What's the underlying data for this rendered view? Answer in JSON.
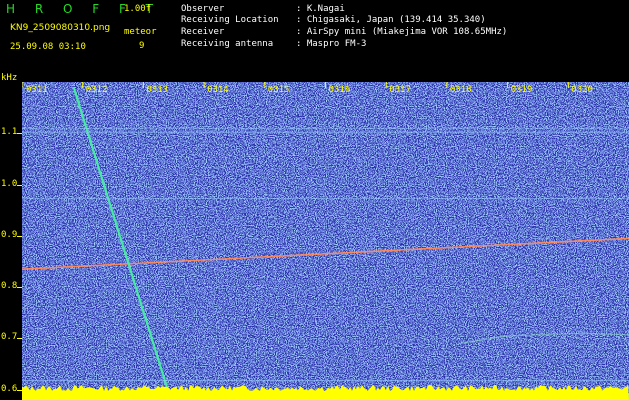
{
  "header": {
    "brand": "H R O F F T",
    "version": "1.00f",
    "filename": "KN9_2509080310.png",
    "datetime": "25.09.08 03:10",
    "meteor_label": "meteor",
    "meteor_count": "9"
  },
  "station": {
    "rows": [
      {
        "label": "Observer",
        "value": ": K.Nagai"
      },
      {
        "label": "Receiving Location",
        "value": ": Chigasaki, Japan (139.414 35.340)"
      },
      {
        "label": "Receiver",
        "value": ": AirSpy mini (Miakejima VOR 108.65MHz)"
      },
      {
        "label": "Receiving antenna",
        "value": ": Maspro FM-3"
      }
    ]
  },
  "chart_data": {
    "type": "heatmap",
    "ylabel": "kHz",
    "yticks": [
      "1.1",
      "1.0",
      "0.9",
      "0.8",
      "0.7",
      "0.6"
    ],
    "ytick_values": [
      1.1,
      1.0,
      0.9,
      0.8,
      0.7,
      0.6
    ],
    "ylim": [
      0.58,
      1.2
    ],
    "xticks": [
      "0311",
      "0312",
      "0313",
      "0314",
      "0315",
      "0316",
      "0317",
      "0318",
      "0319",
      "0320"
    ],
    "xlim_minutes": [
      0,
      10
    ],
    "traces": [
      {
        "kind": "carrier",
        "points": [
          [
            0,
            0.835
          ],
          [
            10,
            0.895
          ]
        ]
      },
      {
        "kind": "meteor-echo",
        "points": [
          [
            0.85,
            1.19
          ],
          [
            2.4,
            0.6
          ]
        ]
      },
      {
        "kind": "faint-line",
        "points": [
          [
            0,
            1.11
          ],
          [
            10,
            1.11
          ]
        ]
      },
      {
        "kind": "faint-line",
        "points": [
          [
            0,
            1.102
          ],
          [
            10,
            1.102
          ]
        ]
      },
      {
        "kind": "faint-line",
        "points": [
          [
            0,
            0.973
          ],
          [
            10,
            0.973
          ]
        ]
      },
      {
        "kind": "faint-line",
        "points": [
          [
            0,
            0.618
          ],
          [
            10,
            0.618
          ]
        ]
      },
      {
        "kind": "faint-curve",
        "points": [
          [
            7.2,
            0.69
          ],
          [
            8.0,
            0.705
          ],
          [
            9.2,
            0.71
          ],
          [
            10,
            0.707
          ]
        ]
      }
    ],
    "colors": {
      "background": "#2a2ea8",
      "noise": "#4a78ff",
      "carrier": "#ff8a5a",
      "echo": "#46f0a0",
      "axis": "#ffff00",
      "grid": "#9fd0ff"
    }
  }
}
